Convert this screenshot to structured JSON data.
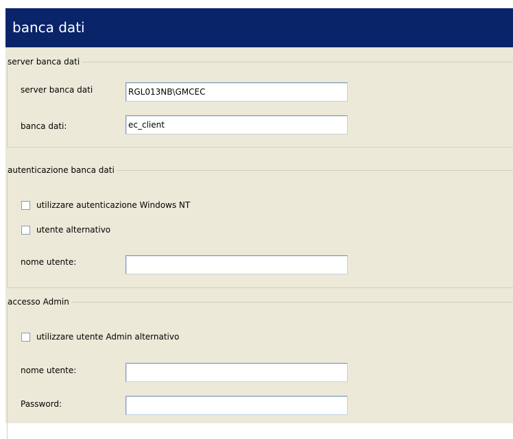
{
  "header": {
    "title": "banca dati"
  },
  "server_section": {
    "legend": "server banca dati",
    "server_label": "server banca dati",
    "server_value": "RGL013NB\\GMCEC",
    "database_label": "banca dati:",
    "database_value": "ec_client"
  },
  "auth_section": {
    "legend": "autenticazione banca dati",
    "windows_nt_label": "utilizzare autenticazione Windows NT",
    "windows_nt_checked": false,
    "alt_user_label": "utente alternativo",
    "alt_user_checked": false,
    "username_label": "nome utente:",
    "username_value": ""
  },
  "admin_section": {
    "legend": "accesso Admin",
    "alt_admin_label": "utilizzare utente Admin alternativo",
    "alt_admin_checked": false,
    "username_label": "nome utente:",
    "username_value": "",
    "password_label": "Password:",
    "password_value": ""
  },
  "colors": {
    "title_bar": "#0a246a",
    "panel_background": "#ece9d8",
    "input_border": "#7f9db9"
  }
}
